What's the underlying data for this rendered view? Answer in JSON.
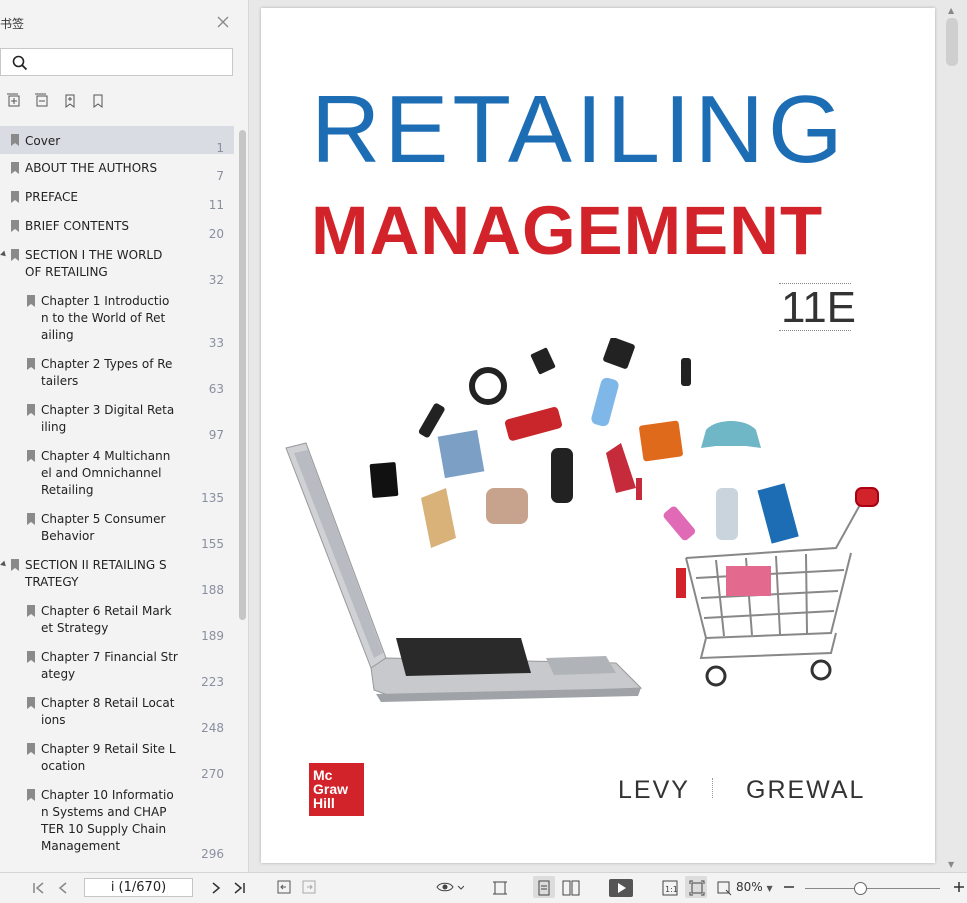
{
  "sidebar": {
    "title": "书签",
    "bookmarks": [
      {
        "label": "Cover",
        "page": "1"
      },
      {
        "label": "ABOUT THE AUTHORS",
        "page": "7"
      },
      {
        "label": "PREFACE",
        "page": "11"
      },
      {
        "label": "BRIEF CONTENTS",
        "page": "20"
      },
      {
        "label": "SECTION I THE WORLD\nOF RETAILING",
        "page": "32"
      },
      {
        "label": "Chapter 1 Introductio\nn to the World  of Ret\nailing",
        "page": "33"
      },
      {
        "label": "Chapter 2 Types of Re\ntailers",
        "page": "63"
      },
      {
        "label": "Chapter 3 Digital Reta\niling",
        "page": "97"
      },
      {
        "label": "Chapter 4 Multichann\nel and  Omnichannel\nRetailing",
        "page": "135"
      },
      {
        "label": "Chapter 5 Consumer\nBehavior",
        "page": "155"
      },
      {
        "label": "SECTION II RETAILING S\nTRATEGY",
        "page": "188"
      },
      {
        "label": "Chapter 6 Retail Mark\net Strategy",
        "page": "189"
      },
      {
        "label": "Chapter 7 Financial Str\nategy",
        "page": "223"
      },
      {
        "label": "Chapter 8 Retail Locat\nions",
        "page": "248"
      },
      {
        "label": "Chapter 9 Retail Site L\nocation",
        "page": "270"
      },
      {
        "label": "Chapter 10 Informatio\nn Systems and  CHAP\nTER 10 Supply Chain\nManagement",
        "page": "296"
      }
    ]
  },
  "document": {
    "title_line1": "RETAILING",
    "title_line2": "MANAGEMENT",
    "edition": "11E",
    "author1": "LEVY",
    "author2": "GREWAL",
    "publisher_logo": [
      "Mc",
      "Graw",
      "Hill"
    ]
  },
  "toolbar": {
    "page_indicator": "i (1/670)",
    "zoom": "80%"
  },
  "colors": {
    "title_blue": "#1d6db5",
    "title_red": "#d2232a"
  }
}
